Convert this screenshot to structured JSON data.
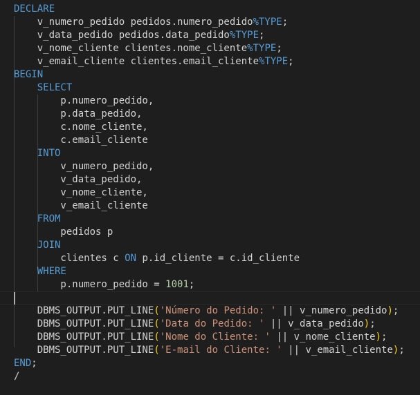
{
  "editor": {
    "theme": {
      "background": "#1e1e1e",
      "text": "#d4d4d4",
      "keyword": "#569cd6",
      "string": "#ce9178",
      "number": "#b5cea8",
      "function": "#dcdcaa",
      "paren": "#ffd700"
    },
    "lines": [
      [
        [
          "kw",
          "DECLARE"
        ]
      ],
      [
        [
          "id",
          "    v_numero_pedido pedidos.numero_pedido"
        ],
        [
          "kw",
          "%TYPE"
        ],
        [
          "id",
          ";"
        ]
      ],
      [
        [
          "id",
          "    v_data_pedido pedidos.data_pedido"
        ],
        [
          "kw",
          "%TYPE"
        ],
        [
          "id",
          ";"
        ]
      ],
      [
        [
          "id",
          "    v_nome_cliente clientes.nome_cliente"
        ],
        [
          "kw",
          "%TYPE"
        ],
        [
          "id",
          ";"
        ]
      ],
      [
        [
          "id",
          "    v_email_cliente clientes.email_cliente"
        ],
        [
          "kw",
          "%TYPE"
        ],
        [
          "id",
          ";"
        ]
      ],
      [
        [
          "kw",
          "BEGIN"
        ]
      ],
      [
        [
          "kw",
          "    SELECT"
        ]
      ],
      [
        [
          "id",
          "        p.numero_pedido,"
        ]
      ],
      [
        [
          "id",
          "        p.data_pedido,"
        ]
      ],
      [
        [
          "id",
          "        c.nome_cliente,"
        ]
      ],
      [
        [
          "id",
          "        c.email_cliente"
        ]
      ],
      [
        [
          "kw",
          "    INTO"
        ]
      ],
      [
        [
          "id",
          "        v_numero_pedido,"
        ]
      ],
      [
        [
          "id",
          "        v_data_pedido,"
        ]
      ],
      [
        [
          "id",
          "        v_nome_cliente,"
        ]
      ],
      [
        [
          "id",
          "        v_email_cliente"
        ]
      ],
      [
        [
          "kw",
          "    FROM"
        ]
      ],
      [
        [
          "id",
          "        pedidos p"
        ]
      ],
      [
        [
          "kw",
          "    JOIN"
        ]
      ],
      [
        [
          "id",
          "        clientes c "
        ],
        [
          "kw",
          "ON"
        ],
        [
          "id",
          " p.id_cliente = c.id_cliente"
        ]
      ],
      [
        [
          "kw",
          "    WHERE"
        ]
      ],
      [
        [
          "id",
          "        p.numero_pedido = "
        ],
        [
          "num",
          "1001"
        ],
        [
          "id",
          ";"
        ]
      ],
      [
        [
          "id",
          ""
        ]
      ],
      [
        [
          "id",
          "    DBMS_OUTPUT.PUT_LINE"
        ],
        [
          "paren",
          "("
        ],
        [
          "str",
          "'Número do Pedido: '"
        ],
        [
          "id",
          " || v_numero_pedido"
        ],
        [
          "paren",
          ")"
        ],
        [
          "id",
          ";"
        ]
      ],
      [
        [
          "id",
          "    DBMS_OUTPUT.PUT_LINE"
        ],
        [
          "paren",
          "("
        ],
        [
          "str",
          "'Data do Pedido: '"
        ],
        [
          "id",
          " || v_data_pedido"
        ],
        [
          "paren",
          ")"
        ],
        [
          "id",
          ";"
        ]
      ],
      [
        [
          "id",
          "    DBMS_OUTPUT.PUT_LINE"
        ],
        [
          "paren",
          "("
        ],
        [
          "str",
          "'Nome do Cliente: '"
        ],
        [
          "id",
          " || v_nome_cliente"
        ],
        [
          "paren",
          ")"
        ],
        [
          "id",
          ";"
        ]
      ],
      [
        [
          "id",
          "    DBMS_OUTPUT.PUT_LINE"
        ],
        [
          "paren",
          "("
        ],
        [
          "str",
          "'E-mail do Cliente: '"
        ],
        [
          "id",
          " || v_email_cliente"
        ],
        [
          "paren",
          ")"
        ],
        [
          "id",
          ";"
        ]
      ],
      [
        [
          "kw",
          "END"
        ],
        [
          "id",
          ";"
        ]
      ],
      [
        [
          "id",
          "/"
        ]
      ]
    ]
  }
}
